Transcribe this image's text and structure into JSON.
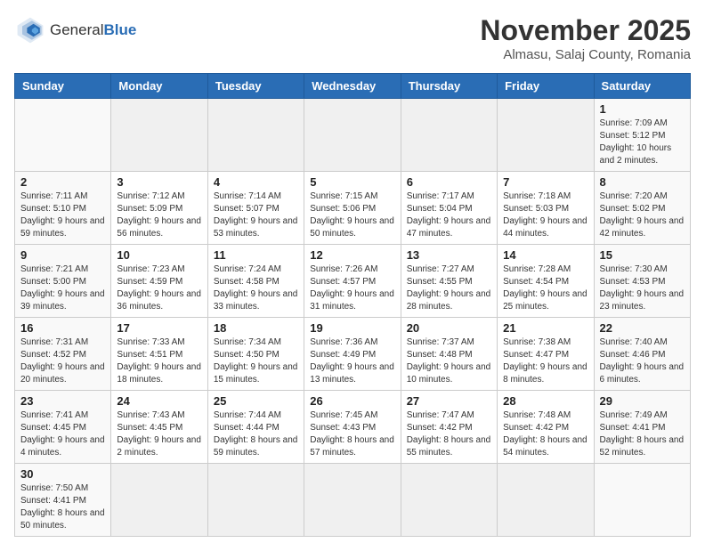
{
  "header": {
    "logo_general": "General",
    "logo_blue": "Blue",
    "month_title": "November 2025",
    "location": "Almasu, Salaj County, Romania"
  },
  "days_of_week": [
    "Sunday",
    "Monday",
    "Tuesday",
    "Wednesday",
    "Thursday",
    "Friday",
    "Saturday"
  ],
  "weeks": [
    [
      {
        "day": "",
        "info": ""
      },
      {
        "day": "",
        "info": ""
      },
      {
        "day": "",
        "info": ""
      },
      {
        "day": "",
        "info": ""
      },
      {
        "day": "",
        "info": ""
      },
      {
        "day": "",
        "info": ""
      },
      {
        "day": "1",
        "info": "Sunrise: 7:09 AM\nSunset: 5:12 PM\nDaylight: 10 hours and 2 minutes."
      }
    ],
    [
      {
        "day": "2",
        "info": "Sunrise: 7:11 AM\nSunset: 5:10 PM\nDaylight: 9 hours and 59 minutes."
      },
      {
        "day": "3",
        "info": "Sunrise: 7:12 AM\nSunset: 5:09 PM\nDaylight: 9 hours and 56 minutes."
      },
      {
        "day": "4",
        "info": "Sunrise: 7:14 AM\nSunset: 5:07 PM\nDaylight: 9 hours and 53 minutes."
      },
      {
        "day": "5",
        "info": "Sunrise: 7:15 AM\nSunset: 5:06 PM\nDaylight: 9 hours and 50 minutes."
      },
      {
        "day": "6",
        "info": "Sunrise: 7:17 AM\nSunset: 5:04 PM\nDaylight: 9 hours and 47 minutes."
      },
      {
        "day": "7",
        "info": "Sunrise: 7:18 AM\nSunset: 5:03 PM\nDaylight: 9 hours and 44 minutes."
      },
      {
        "day": "8",
        "info": "Sunrise: 7:20 AM\nSunset: 5:02 PM\nDaylight: 9 hours and 42 minutes."
      }
    ],
    [
      {
        "day": "9",
        "info": "Sunrise: 7:21 AM\nSunset: 5:00 PM\nDaylight: 9 hours and 39 minutes."
      },
      {
        "day": "10",
        "info": "Sunrise: 7:23 AM\nSunset: 4:59 PM\nDaylight: 9 hours and 36 minutes."
      },
      {
        "day": "11",
        "info": "Sunrise: 7:24 AM\nSunset: 4:58 PM\nDaylight: 9 hours and 33 minutes."
      },
      {
        "day": "12",
        "info": "Sunrise: 7:26 AM\nSunset: 4:57 PM\nDaylight: 9 hours and 31 minutes."
      },
      {
        "day": "13",
        "info": "Sunrise: 7:27 AM\nSunset: 4:55 PM\nDaylight: 9 hours and 28 minutes."
      },
      {
        "day": "14",
        "info": "Sunrise: 7:28 AM\nSunset: 4:54 PM\nDaylight: 9 hours and 25 minutes."
      },
      {
        "day": "15",
        "info": "Sunrise: 7:30 AM\nSunset: 4:53 PM\nDaylight: 9 hours and 23 minutes."
      }
    ],
    [
      {
        "day": "16",
        "info": "Sunrise: 7:31 AM\nSunset: 4:52 PM\nDaylight: 9 hours and 20 minutes."
      },
      {
        "day": "17",
        "info": "Sunrise: 7:33 AM\nSunset: 4:51 PM\nDaylight: 9 hours and 18 minutes."
      },
      {
        "day": "18",
        "info": "Sunrise: 7:34 AM\nSunset: 4:50 PM\nDaylight: 9 hours and 15 minutes."
      },
      {
        "day": "19",
        "info": "Sunrise: 7:36 AM\nSunset: 4:49 PM\nDaylight: 9 hours and 13 minutes."
      },
      {
        "day": "20",
        "info": "Sunrise: 7:37 AM\nSunset: 4:48 PM\nDaylight: 9 hours and 10 minutes."
      },
      {
        "day": "21",
        "info": "Sunrise: 7:38 AM\nSunset: 4:47 PM\nDaylight: 9 hours and 8 minutes."
      },
      {
        "day": "22",
        "info": "Sunrise: 7:40 AM\nSunset: 4:46 PM\nDaylight: 9 hours and 6 minutes."
      }
    ],
    [
      {
        "day": "23",
        "info": "Sunrise: 7:41 AM\nSunset: 4:45 PM\nDaylight: 9 hours and 4 minutes."
      },
      {
        "day": "24",
        "info": "Sunrise: 7:43 AM\nSunset: 4:45 PM\nDaylight: 9 hours and 2 minutes."
      },
      {
        "day": "25",
        "info": "Sunrise: 7:44 AM\nSunset: 4:44 PM\nDaylight: 8 hours and 59 minutes."
      },
      {
        "day": "26",
        "info": "Sunrise: 7:45 AM\nSunset: 4:43 PM\nDaylight: 8 hours and 57 minutes."
      },
      {
        "day": "27",
        "info": "Sunrise: 7:47 AM\nSunset: 4:42 PM\nDaylight: 8 hours and 55 minutes."
      },
      {
        "day": "28",
        "info": "Sunrise: 7:48 AM\nSunset: 4:42 PM\nDaylight: 8 hours and 54 minutes."
      },
      {
        "day": "29",
        "info": "Sunrise: 7:49 AM\nSunset: 4:41 PM\nDaylight: 8 hours and 52 minutes."
      }
    ],
    [
      {
        "day": "30",
        "info": "Sunrise: 7:50 AM\nSunset: 4:41 PM\nDaylight: 8 hours and 50 minutes."
      },
      {
        "day": "",
        "info": ""
      },
      {
        "day": "",
        "info": ""
      },
      {
        "day": "",
        "info": ""
      },
      {
        "day": "",
        "info": ""
      },
      {
        "day": "",
        "info": ""
      },
      {
        "day": "",
        "info": ""
      }
    ]
  ]
}
